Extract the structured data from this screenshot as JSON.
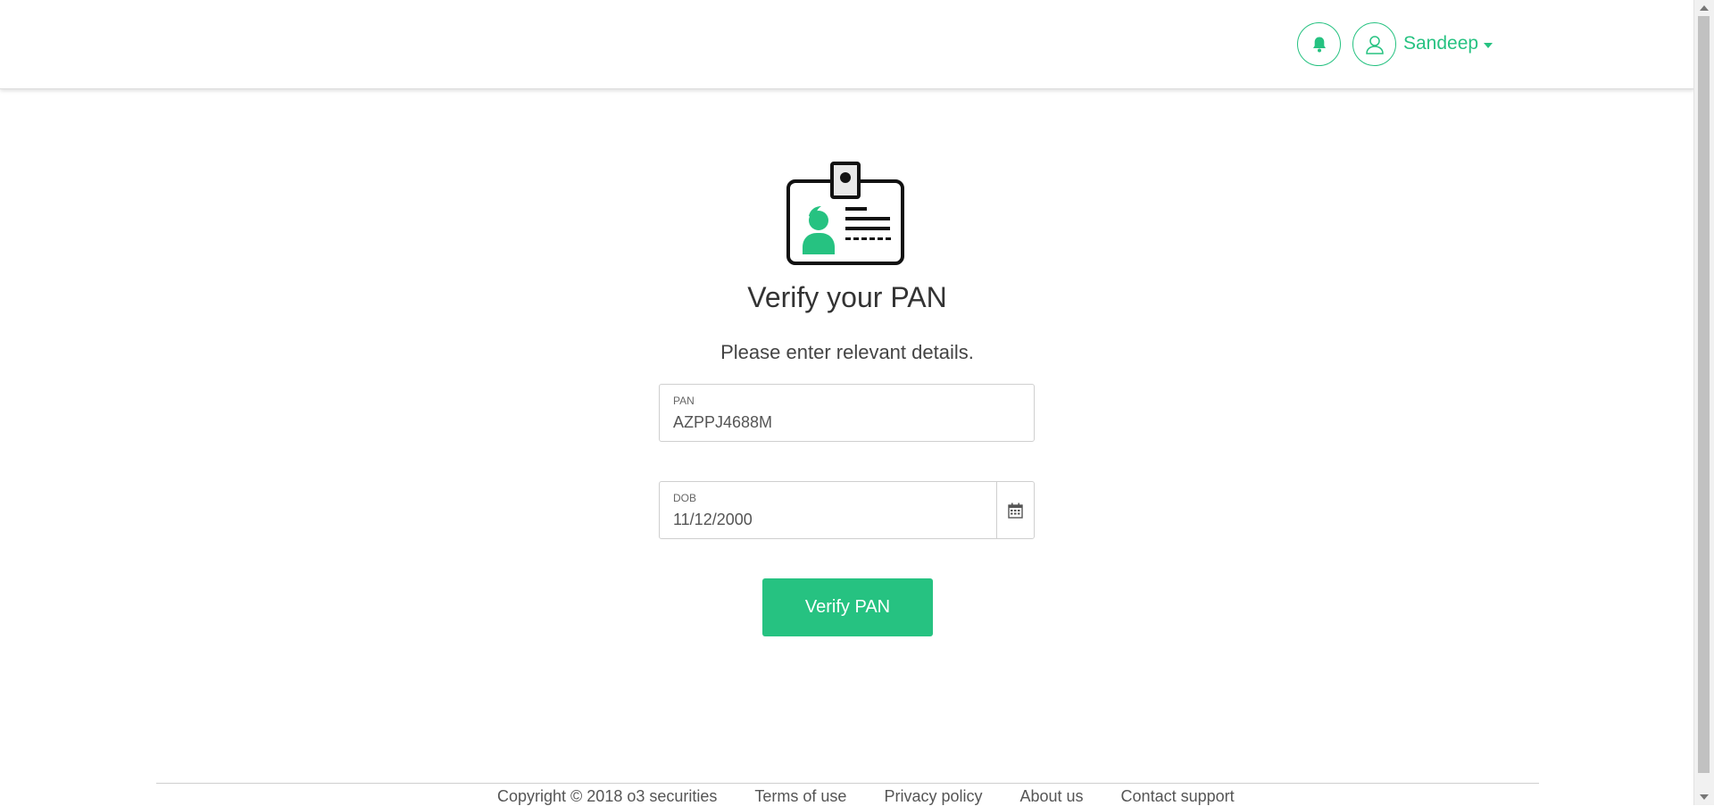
{
  "header": {
    "user_name": "Sandeep",
    "icons": {
      "notification": "bell-icon",
      "user": "user-icon",
      "menu": "caret-down-icon"
    }
  },
  "main": {
    "illustration": "id-card-icon",
    "title": "Verify your PAN",
    "subtitle": "Please enter relevant details.",
    "pan": {
      "label": "PAN",
      "value": "AZPPJ4688M"
    },
    "dob": {
      "label": "DOB",
      "value": "11/12/2000",
      "icon": "calendar-icon"
    },
    "verify_button": "Verify PAN"
  },
  "footer": {
    "copyright": "Copyright © 2018 o3 securities",
    "links": [
      "Terms of use",
      "Privacy policy",
      "About us",
      "Contact support"
    ]
  },
  "colors": {
    "accent": "#26c281",
    "text": "#333333",
    "border": "#cfcfcf"
  }
}
